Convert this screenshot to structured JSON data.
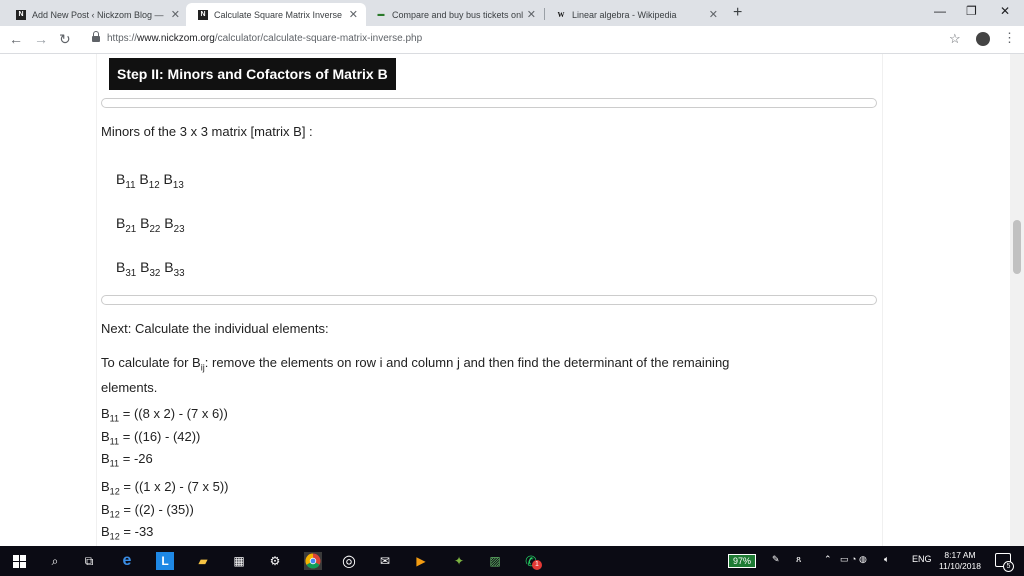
{
  "tabs": [
    {
      "label": "Add New Post ‹ Nickzom Blog —",
      "favicon": "nickzom-icon",
      "active": false
    },
    {
      "label": "Calculate Square Matrix Inverse",
      "favicon": "nickzom-icon",
      "active": true
    },
    {
      "label": "Compare and buy bus tickets onl",
      "favicon": "bus-icon",
      "active": false
    },
    {
      "label": "Linear algebra - Wikipedia",
      "favicon": "wikipedia-icon",
      "active": false
    }
  ],
  "address_bar": {
    "scheme": "https://",
    "host": "www.nickzom.org",
    "path": "/calculator/calculate-square-matrix-inverse.php"
  },
  "page": {
    "step_title": "Step II: Minors and Cofactors of Matrix B",
    "minors_intro": "Minors of the 3 x 3 matrix [matrix B] :",
    "matrix_rows": [
      [
        {
          "base": "B",
          "sub": "11"
        },
        {
          "base": "B",
          "sub": "12"
        },
        {
          "base": "B",
          "sub": "13"
        }
      ],
      [
        {
          "base": "B",
          "sub": "21"
        },
        {
          "base": "B",
          "sub": "22"
        },
        {
          "base": "B",
          "sub": "23"
        }
      ],
      [
        {
          "base": "B",
          "sub": "31"
        },
        {
          "base": "B",
          "sub": "32"
        },
        {
          "base": "B",
          "sub": "33"
        }
      ]
    ],
    "next_text": "Next: Calculate the individual elements:",
    "howto": {
      "prefix": "To calculate for B",
      "sub": "ij",
      "line1_rest": ": remove the elements on row i and column j and then find the determinant of the remaining",
      "line2": "elements."
    },
    "calc_blocks": [
      {
        "lines": [
          {
            "base": "B",
            "sub": "11",
            "rest": " = ((8 x 2) - (7 x 6))"
          },
          {
            "base": "B",
            "sub": "11",
            "rest": " = ((16) - (42))"
          },
          {
            "base": "B",
            "sub": "11",
            "rest": " = -26"
          }
        ]
      },
      {
        "lines": [
          {
            "base": "B",
            "sub": "12",
            "rest": " = ((1 x 2) - (7 x 5))"
          },
          {
            "base": "B",
            "sub": "12",
            "rest": " = ((2) - (35))"
          },
          {
            "base": "B",
            "sub": "12",
            "rest": " = -33"
          }
        ]
      }
    ]
  },
  "taskbar": {
    "battery": "97%",
    "language": "ENG",
    "time": "8:17 AM",
    "date": "11/10/2018",
    "notification_count": "5",
    "whatsapp_badge": "1"
  }
}
